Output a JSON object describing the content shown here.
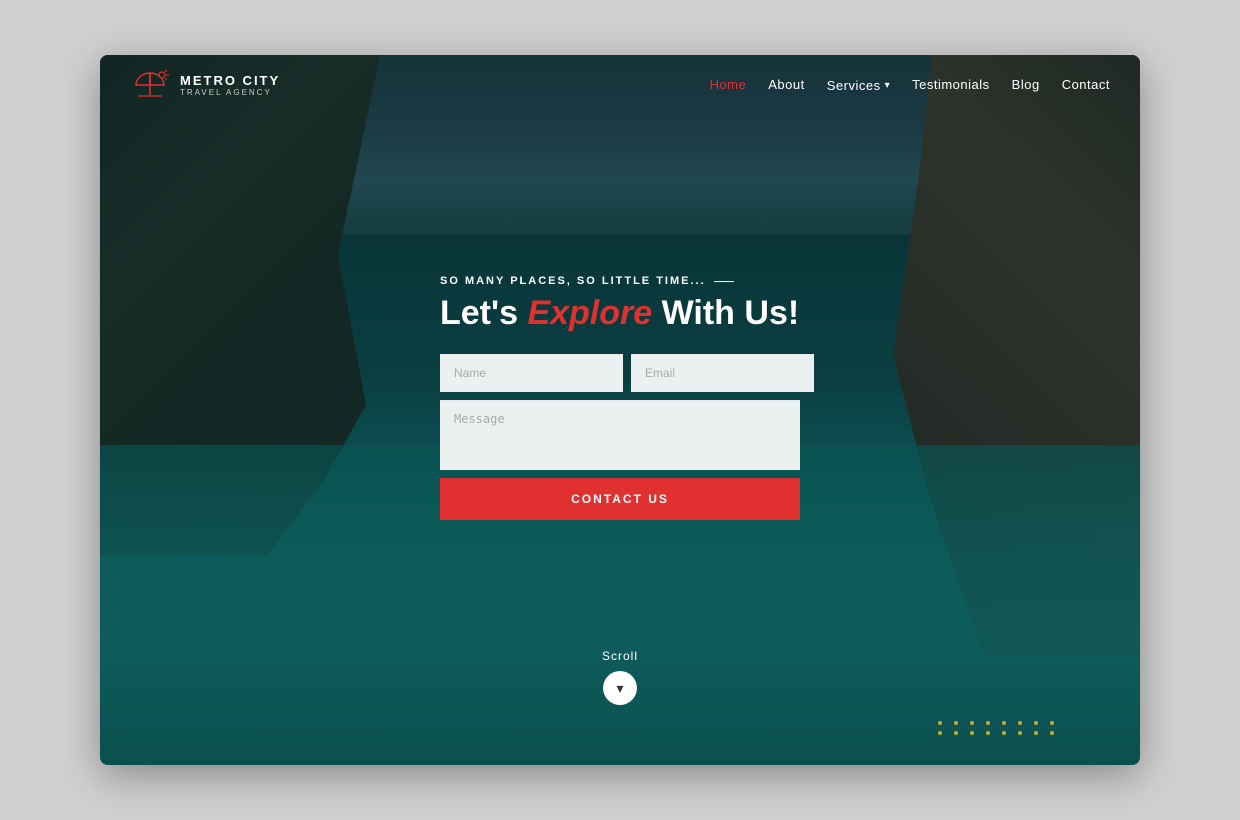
{
  "browser": {
    "title": "Metro City Travel Agency"
  },
  "logo": {
    "title": "METRO CITY",
    "subtitle": "TRAVEL AGENCY"
  },
  "nav": {
    "home_label": "Home",
    "about_label": "About",
    "services_label": "Services",
    "testimonials_label": "Testimonials",
    "blog_label": "Blog",
    "contact_label": "Contact"
  },
  "hero": {
    "tagline": "SO MANY PLACES, SO LITTLE TIME...",
    "title_start": "Let's ",
    "title_highlight": "Explore",
    "title_end": " With Us!"
  },
  "form": {
    "name_placeholder": "Name",
    "email_placeholder": "Email",
    "message_placeholder": "Message",
    "submit_label": "CONTACT US"
  },
  "scroll": {
    "label": "Scroll",
    "arrow": "▾"
  },
  "dots": {
    "rows": 2,
    "cols": 8
  }
}
